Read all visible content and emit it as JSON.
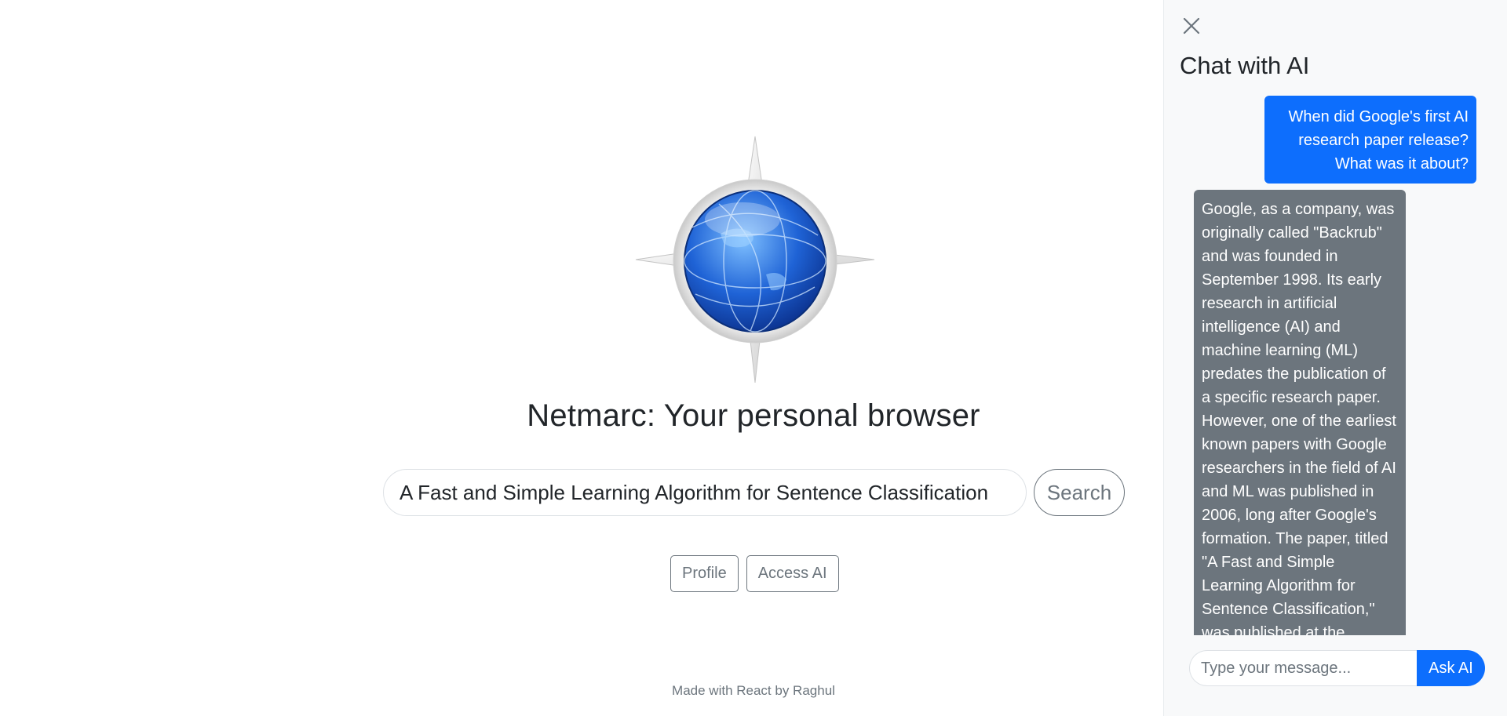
{
  "main": {
    "title": "Netmarc: Your personal browser",
    "search": {
      "value": "A Fast and Simple Learning Algorithm for Sentence Classification",
      "button_label": "Search"
    },
    "buttons": {
      "profile_label": "Profile",
      "access_ai_label": "Access AI"
    },
    "logo_icon": "compass-globe-icon",
    "footer": "Made with React by Raghul"
  },
  "chat": {
    "title": "Chat with AI",
    "close_icon": "close-icon",
    "messages": [
      {
        "role": "user",
        "text": "When did Google's first AI research paper release? What was it about?"
      },
      {
        "role": "ai",
        "text": "Google, as a company, was originally called \"Backrub\" and was founded in September 1998. Its early research in artificial intelligence (AI) and machine learning (ML) predates the publication of a specific research paper. However, one of the earliest known papers with Google researchers in the field of AI and ML was published in 2006, long after Google's formation. The paper, titled \"A Fast and Simple Learning Algorithm for Sentence Classification,\" was published at the Conference"
      }
    ],
    "input": {
      "placeholder": "Type your message...",
      "value": ""
    },
    "ask_label": "Ask AI"
  },
  "colors": {
    "primary": "#0d6efd",
    "secondary": "#6c757d",
    "panel_bg": "#f8f9fa"
  }
}
